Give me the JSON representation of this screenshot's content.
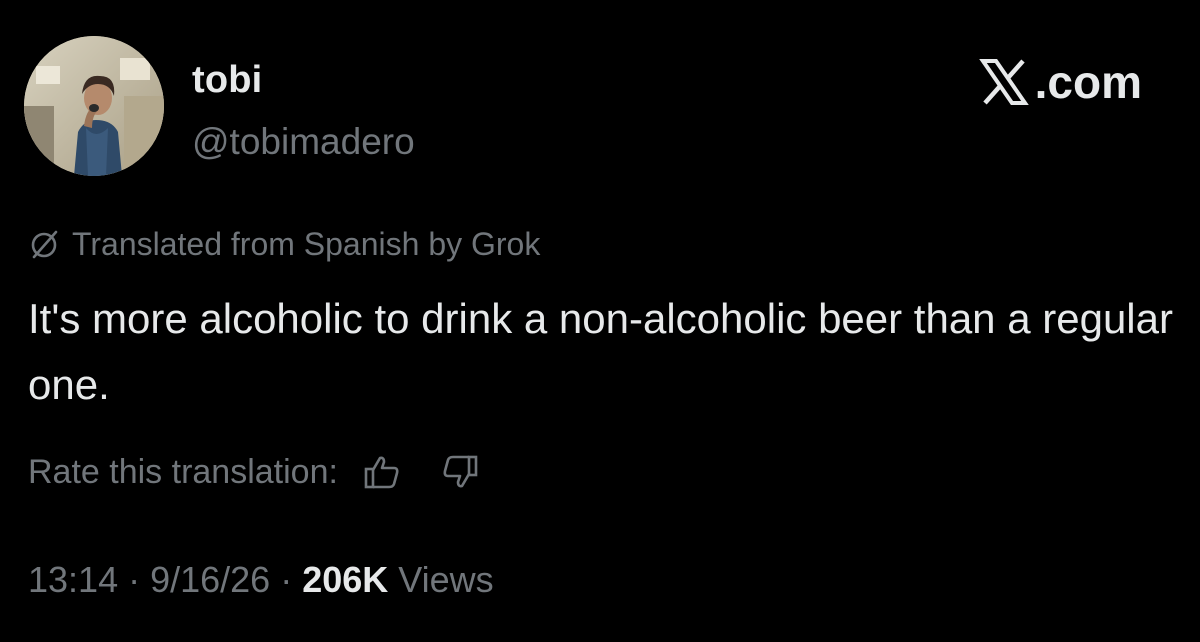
{
  "author": {
    "display_name": "tobi",
    "handle": "@tobimadero",
    "avatar_icon": "profile-photo"
  },
  "brand": {
    "label": ".com",
    "logo_icon": "x-logo-icon"
  },
  "translation": {
    "icon": "translate-grok-icon",
    "note": "Translated from Spanish by Grok"
  },
  "tweet": {
    "text": "It's more alcoholic to drink a non-alcoholic beer than a regular one."
  },
  "rating": {
    "label": "Rate this translation:",
    "thumbs_up_icon": "thumbs-up-icon",
    "thumbs_down_icon": "thumbs-down-icon"
  },
  "meta": {
    "time": "13:14",
    "separator": "·",
    "date": "9/16/26",
    "views_count": "206K",
    "views_label": "Views"
  },
  "colors": {
    "background": "#000000",
    "primary_text": "#e7e9ea",
    "secondary_text": "#71767b"
  }
}
